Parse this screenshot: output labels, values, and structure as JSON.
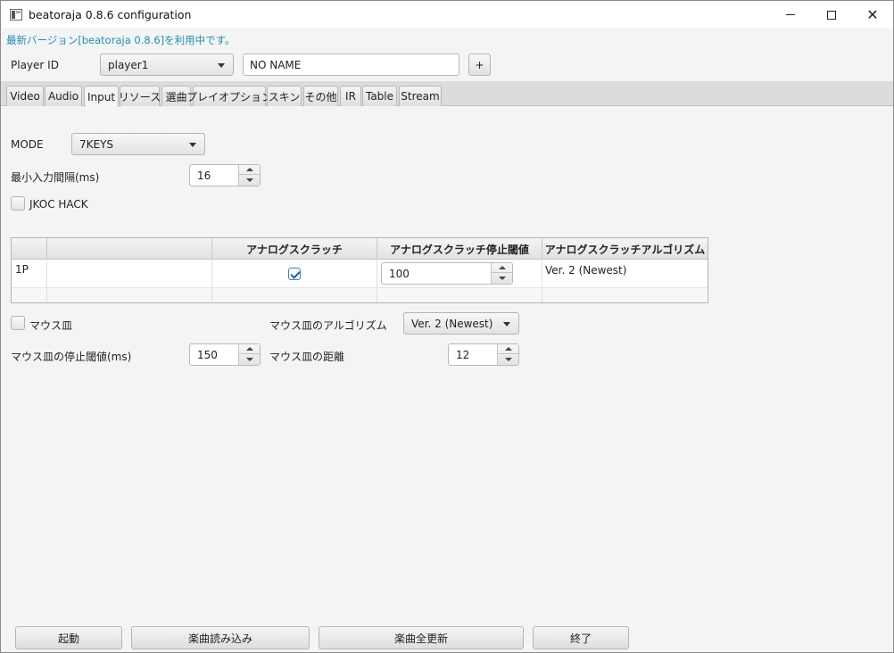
{
  "window": {
    "title": "beatoraja 0.8.6 configuration"
  },
  "notice": "最新バージョン[beatoraja 0.8.6]を利用中です。",
  "player": {
    "label": "Player ID",
    "selected": "player1",
    "name_value": "NO NAME",
    "add_label": "+"
  },
  "tabs": [
    {
      "label": "Video"
    },
    {
      "label": "Audio"
    },
    {
      "label": "Input",
      "active": true
    },
    {
      "label": "リソース"
    },
    {
      "label": "選曲"
    },
    {
      "label": "プレイオプション"
    },
    {
      "label": "スキン"
    },
    {
      "label": "その他"
    },
    {
      "label": "IR"
    },
    {
      "label": "Table"
    },
    {
      "label": "Stream"
    }
  ],
  "input": {
    "mode_label": "MODE",
    "mode_value": "7KEYS",
    "min_interval_label": "最小入力間隔(ms)",
    "min_interval_value": "16",
    "jkoc_label": "JKOC HACK",
    "jkoc_checked": false
  },
  "table": {
    "headers": [
      "",
      "",
      "アナログスクラッチ",
      "アナログスクラッチ停止閾値",
      "アナログスクラッチアルゴリズム"
    ],
    "rows": [
      {
        "player": "1P",
        "analog_scratch": true,
        "threshold": "100",
        "algorithm": "Ver. 2 (Newest)"
      }
    ]
  },
  "mouse": {
    "scratch_label": "マウス皿",
    "scratch_checked": false,
    "algorithm_label": "マウス皿のアルゴリズム",
    "algorithm_value": "Ver. 2 (Newest)",
    "stop_threshold_label": "マウス皿の停止閾値(ms)",
    "stop_threshold_value": "150",
    "distance_label": "マウス皿の距離",
    "distance_value": "12"
  },
  "buttons": {
    "start": "起動",
    "load_songs": "楽曲読み込み",
    "update_all": "楽曲全更新",
    "exit": "終了"
  },
  "colors": {
    "notice": "#1f8fb5",
    "check_accent": "#2f7fd6"
  }
}
